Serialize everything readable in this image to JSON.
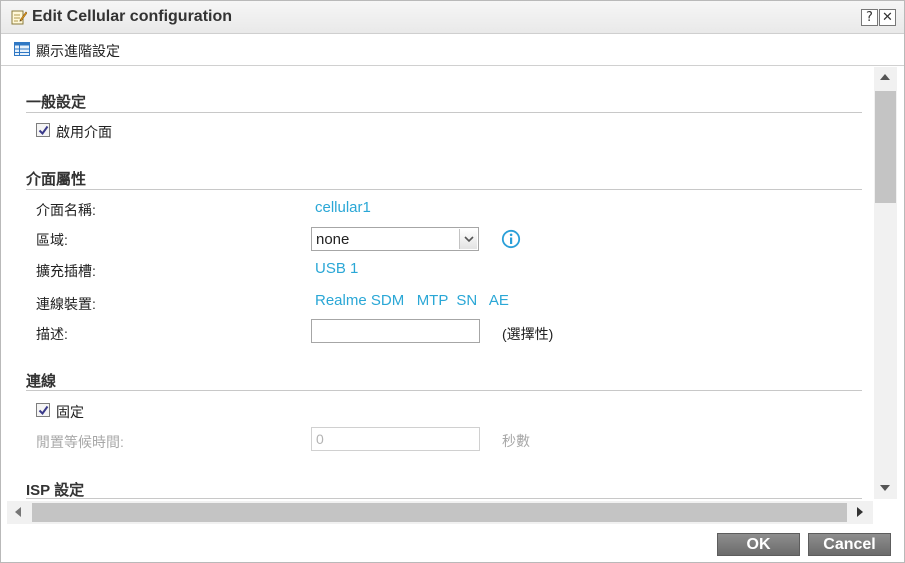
{
  "window": {
    "title": "Edit Cellular configuration",
    "help_glyph": "?",
    "close_glyph": "✕"
  },
  "toolbar": {
    "advanced_label": "顯示進階設定"
  },
  "general": {
    "title": "一般設定",
    "enable_label": "啟用介面",
    "enable_checked": true
  },
  "properties": {
    "title": "介面屬性",
    "name_label": "介面名稱:",
    "name_value": "cellular1",
    "zone_label": "區域:",
    "zone_value": "none",
    "slot_label": "擴充插槽:",
    "slot_value": "USB 1",
    "device_label": "連線裝置:",
    "device_value": "Realme SDM   MTP  SN   AE",
    "description_label": "描述:",
    "description_value": "",
    "description_hint": "(選擇性)"
  },
  "connection": {
    "title": "連線",
    "fixed_label": "固定",
    "fixed_checked": true,
    "idle_label": "閒置等候時間:",
    "idle_value": "0",
    "idle_unit": "秒數"
  },
  "isp": {
    "title": "ISP 設定"
  },
  "footer": {
    "ok_label": "OK",
    "cancel_label": "Cancel"
  },
  "colors": {
    "link": "#2aa7d6",
    "button": "#7a7a7a",
    "disabled_text": "#a8a8a8"
  }
}
